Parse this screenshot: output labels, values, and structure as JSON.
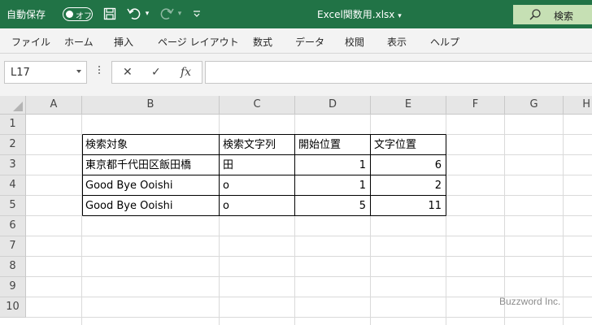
{
  "title_bar": {
    "autosave_label": "自動保存",
    "autosave_state": "オフ",
    "document_title": "Excel関数用.xlsx",
    "search_label": "検索",
    "accent_color": "#217346",
    "icons": [
      "save-icon",
      "undo-icon",
      "redo-icon",
      "customize-icon",
      "search-icon"
    ]
  },
  "ribbon": {
    "tabs": [
      "ファイル",
      "ホーム",
      "挿入",
      "ページ レイアウト",
      "数式",
      "データ",
      "校閲",
      "表示",
      "ヘルプ"
    ]
  },
  "formula_bar": {
    "name_box": "L17",
    "cancel_icon": "✕",
    "enter_icon": "✓",
    "function_icon": "fx",
    "content": ""
  },
  "sheet": {
    "columns": [
      "A",
      "B",
      "C",
      "D",
      "E",
      "F",
      "G",
      "H"
    ],
    "rows": [
      "1",
      "2",
      "3",
      "4",
      "5",
      "6",
      "7",
      "8",
      "9",
      "10"
    ],
    "table": {
      "headers": [
        "検索対象",
        "検索文字列",
        "開始位置",
        "文字位置"
      ],
      "rows": [
        [
          "東京都千代田区飯田橋",
          "田",
          "1",
          "6"
        ],
        [
          "Good Bye Ooishi",
          "o",
          "1",
          "2"
        ],
        [
          "Good Bye Ooishi",
          "o",
          "5",
          "11"
        ]
      ]
    }
  },
  "watermark": "Buzzword Inc."
}
